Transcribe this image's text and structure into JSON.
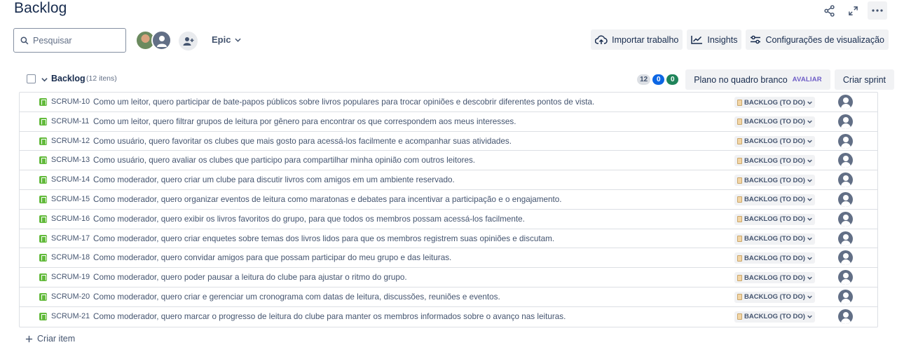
{
  "page": {
    "title": "Backlog"
  },
  "top_actions": {
    "icons": [
      "share-icon",
      "fullscreen-icon",
      "more-icon"
    ]
  },
  "toolbar": {
    "search_placeholder": "Pesquisar",
    "epic_label": "Epic",
    "import_label": "Importar trabalho",
    "insights_label": "Insights",
    "view_settings_label": "Configurações de visualização"
  },
  "backlog": {
    "title": "Backlog",
    "count_label": "(12 itens)",
    "points_grey": "12",
    "points_blue": "0",
    "points_green": "0",
    "whiteboard_label": "Plano no quadro branco",
    "whiteboard_tag": "AVALIAR",
    "create_sprint_label": "Criar sprint",
    "items": [
      {
        "key": "SCRUM-10",
        "summary": "Como um leitor, quero participar de bate-papos públicos sobre livros populares para trocar opiniões e descobrir diferentes pontos de vista.",
        "status": "BACKLOG (TO DO)"
      },
      {
        "key": "SCRUM-11",
        "summary": "Como um leitor, quero filtrar grupos de leitura por gênero para encontrar os que correspondem aos meus interesses.",
        "status": "BACKLOG (TO DO)"
      },
      {
        "key": "SCRUM-12",
        "summary": "Como usuário, quero favoritar os clubes que mais gosto para acessá-los facilmente e acompanhar suas atividades.",
        "status": "BACKLOG (TO DO)"
      },
      {
        "key": "SCRUM-13",
        "summary": "Como usuário, quero avaliar os clubes que participo para compartilhar minha opinião com outros leitores.",
        "status": "BACKLOG (TO DO)"
      },
      {
        "key": "SCRUM-14",
        "summary": "Como moderador, quero criar um clube para discutir livros com amigos em um ambiente reservado.",
        "status": "BACKLOG (TO DO)"
      },
      {
        "key": "SCRUM-15",
        "summary": "Como moderador, quero organizar eventos de leitura como maratonas e debates para incentivar a participação e o engajamento.",
        "status": "BACKLOG (TO DO)"
      },
      {
        "key": "SCRUM-16",
        "summary": "Como moderador, quero exibir os livros favoritos do grupo, para que todos os membros possam acessá-los facilmente.",
        "status": "BACKLOG (TO DO)"
      },
      {
        "key": "SCRUM-17",
        "summary": "Como moderador, quero criar enquetes sobre temas dos livros lidos para que os membros registrem suas opiniões e discutam.",
        "status": "BACKLOG (TO DO)"
      },
      {
        "key": "SCRUM-18",
        "summary": "Como moderador, quero convidar amigos para que possam participar do meu grupo e das leituras.",
        "status": "BACKLOG (TO DO)"
      },
      {
        "key": "SCRUM-19",
        "summary": "Como moderador, quero poder pausar a leitura do clube para ajustar o ritmo do grupo.",
        "status": "BACKLOG (TO DO)"
      },
      {
        "key": "SCRUM-20",
        "summary": "Como moderador, quero criar e gerenciar um cronograma com datas de leitura, discussões, reuniões e eventos.",
        "status": "BACKLOG (TO DO)"
      },
      {
        "key": "SCRUM-21",
        "summary": "Como moderador, quero marcar o progresso de leitura do clube para manter os membros informados sobre o avanço nas leituras.",
        "status": "BACKLOG (TO DO)"
      }
    ]
  },
  "footer": {
    "create_item_label": "Criar item"
  },
  "colors": {
    "story": "#63ba3c",
    "text": "#172b4d",
    "tag": "#6e5dc6",
    "blue_pill": "#0c66e4",
    "green_pill": "#1f845a"
  }
}
